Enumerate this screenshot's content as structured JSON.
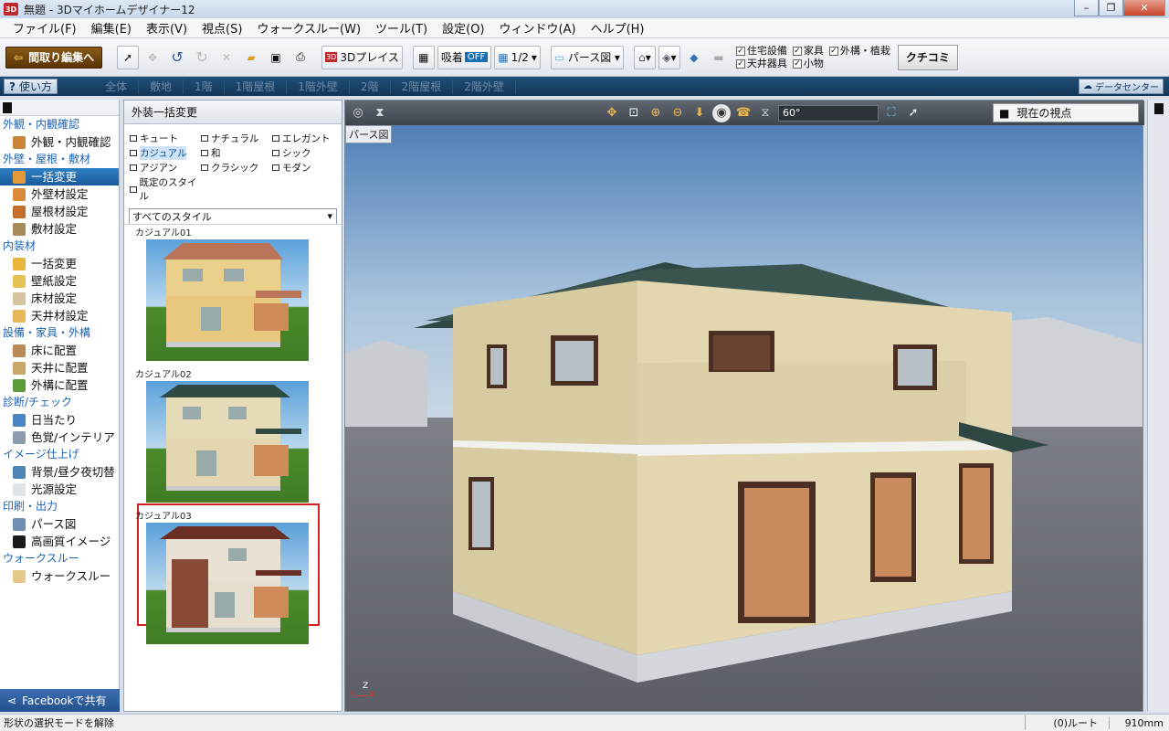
{
  "window": {
    "title": "無題 - 3Dマイホームデザイナー12",
    "app_icon": "3D"
  },
  "menu": [
    "ファイル(F)",
    "編集(E)",
    "表示(V)",
    "視点(S)",
    "ウォークスルー(W)",
    "ツール(T)",
    "設定(O)",
    "ウィンドウ(A)",
    "ヘルプ(H)"
  ],
  "toolbar": {
    "madori_label": "間取り編集へ",
    "place_label": "3Dプレイス",
    "snap_label": "吸着",
    "snap_state": "OFF",
    "grid_value": "1/2",
    "view_mode": "パース図",
    "checks": [
      {
        "label": "住宅設備",
        "checked": true
      },
      {
        "label": "家具",
        "checked": true
      },
      {
        "label": "外構・植栽",
        "checked": true
      },
      {
        "label": "天井器具",
        "checked": true
      },
      {
        "label": "小物",
        "checked": true
      }
    ],
    "kuchikomi": "クチコミ"
  },
  "tabbar": {
    "howto": "使い方",
    "tabs": [
      "全体",
      "敷地",
      "1階",
      "1階屋根",
      "1階外壁",
      "2階",
      "2階屋根",
      "2階外壁"
    ],
    "datacenter": "データセンター"
  },
  "leftnav": {
    "sections": [
      {
        "header": "外観・内観確認",
        "items": [
          {
            "label": "外観・内観確認",
            "selected": false
          }
        ]
      },
      {
        "header": "外壁・屋根・敷材",
        "items": [
          {
            "label": "一括変更",
            "selected": true
          },
          {
            "label": "外壁材設定",
            "selected": false
          },
          {
            "label": "屋根材設定",
            "selected": false
          },
          {
            "label": "敷材設定",
            "selected": false
          }
        ]
      },
      {
        "header": "内装材",
        "items": [
          {
            "label": "一括変更",
            "selected": false
          },
          {
            "label": "壁紙設定",
            "selected": false
          },
          {
            "label": "床材設定",
            "selected": false
          },
          {
            "label": "天井材設定",
            "selected": false
          }
        ]
      },
      {
        "header": "設備・家具・外構",
        "items": [
          {
            "label": "床に配置",
            "selected": false
          },
          {
            "label": "天井に配置",
            "selected": false
          },
          {
            "label": "外構に配置",
            "selected": false
          }
        ]
      },
      {
        "header": "診断/チェック",
        "items": [
          {
            "label": "日当たり",
            "selected": false
          },
          {
            "label": "色覚/インテリア",
            "selected": false
          }
        ]
      },
      {
        "header": "イメージ仕上げ",
        "items": [
          {
            "label": "背景/昼夕夜切替",
            "selected": false
          },
          {
            "label": "光源設定",
            "selected": false
          }
        ]
      },
      {
        "header": "印刷・出力",
        "items": [
          {
            "label": "パース図",
            "selected": false
          },
          {
            "label": "高画質イメージ",
            "selected": false
          }
        ]
      },
      {
        "header": "ウォークスルー",
        "items": [
          {
            "label": "ウォークスルー",
            "selected": false
          }
        ]
      }
    ],
    "facebook": "Facebookで共有"
  },
  "panel": {
    "title": "外装一括変更",
    "styles": [
      "キュート",
      "ナチュラル",
      "エレガント",
      "カジュアル",
      "和",
      "シック",
      "アジアン",
      "クラシック",
      "モダン",
      "既定のスタイル"
    ],
    "selected_style": "カジュアル",
    "filter": "すべてのスタイル",
    "items": [
      "カジュアル01",
      "カジュアル02",
      "カジュアル03"
    ],
    "selected_item": "カジュアル02"
  },
  "viewport": {
    "label": "パース図",
    "angle": "60°",
    "viewpoint": "現在の視点",
    "axis_z": "Z",
    "axis_y": "Y",
    "axis_x": "X"
  },
  "status": {
    "message": "形状の選択モードを解除",
    "route": "(0)ルート",
    "grid": "910mm"
  }
}
